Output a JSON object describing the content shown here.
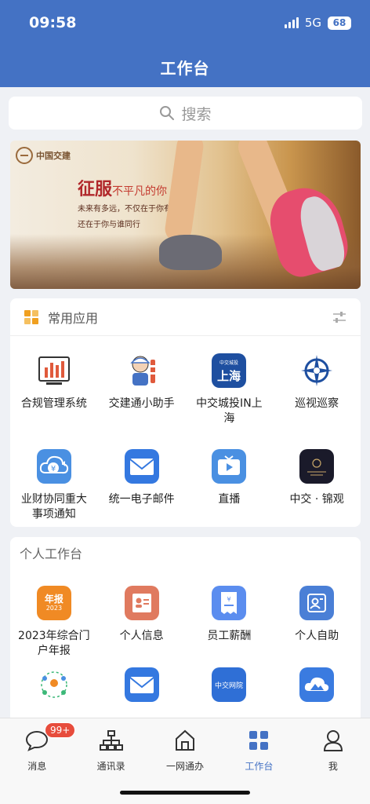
{
  "status": {
    "time": "09:58",
    "network": "5G",
    "battery": "68"
  },
  "header": {
    "title": "工作台"
  },
  "search": {
    "placeholder": "搜索"
  },
  "banner": {
    "brand": "中国交建",
    "slogan": "征服",
    "slogan_sub": "不平凡的你",
    "line1": "未来有多远，不仅在于你有梦想",
    "line2": "还在于你与谁同行"
  },
  "common_apps": {
    "title": "常用应用",
    "items": [
      {
        "label": "合规管理系统",
        "icon": "bar-chart-icon"
      },
      {
        "label": "交建通小助手",
        "icon": "worker-mascot-icon"
      },
      {
        "label": "中交城投IN上海",
        "icon": "shanghai-logo-icon"
      },
      {
        "label": "巡视巡察",
        "icon": "compass-emblem-icon"
      },
      {
        "label": "业财协同重大事项通知",
        "icon": "cloud-yuan-icon"
      },
      {
        "label": "统一电子邮件",
        "icon": "mail-icon"
      },
      {
        "label": "直播",
        "icon": "tv-play-icon"
      },
      {
        "label": "中交 · 锦观",
        "icon": "jinguan-logo-icon"
      }
    ]
  },
  "personal": {
    "title": "个人工作台",
    "items": [
      {
        "label": "2023年综合门户年报",
        "icon": "annual-report-icon",
        "icon_text": "年报",
        "icon_sub": "2023"
      },
      {
        "label": "个人信息",
        "icon": "id-card-icon"
      },
      {
        "label": "员工薪酬",
        "icon": "salary-receipt-icon"
      },
      {
        "label": "个人自助",
        "icon": "self-service-icon"
      }
    ],
    "partial_icons": [
      "people-network-icon",
      "mail-icon",
      "network-college-icon",
      "cloud-mountain-icon"
    ],
    "partial_icon_text": "中交网院"
  },
  "bottom_nav": {
    "items": [
      {
        "label": "消息",
        "icon": "chat-icon",
        "badge": "99+"
      },
      {
        "label": "通讯录",
        "icon": "org-chart-icon"
      },
      {
        "label": "一网通办",
        "icon": "home-icon"
      },
      {
        "label": "工作台",
        "icon": "grid-icon"
      },
      {
        "label": "我",
        "icon": "person-icon"
      }
    ]
  },
  "colors": {
    "primary": "#4472c4",
    "badge": "#e74c3c",
    "orange": "#f08a24"
  }
}
